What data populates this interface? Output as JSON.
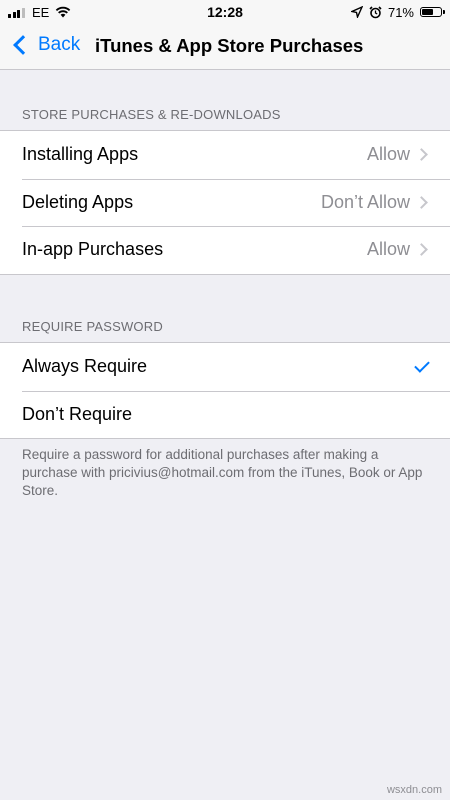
{
  "status_bar": {
    "carrier": "EE",
    "time": "12:28",
    "battery_percent": "71%",
    "battery_level": 0.71,
    "icons": [
      "signal-icon",
      "wifi-icon",
      "location-icon",
      "alarm-icon",
      "battery-icon"
    ]
  },
  "nav": {
    "back_label": "Back",
    "title": "iTunes & App Store Purchases"
  },
  "store_section": {
    "header": "STORE PURCHASES & RE-DOWNLOADS",
    "rows": [
      {
        "label": "Installing Apps",
        "value": "Allow"
      },
      {
        "label": "Deleting Apps",
        "value": "Don’t Allow"
      },
      {
        "label": "In-app Purchases",
        "value": "Allow"
      }
    ]
  },
  "password_section": {
    "header": "REQUIRE PASSWORD",
    "rows": [
      {
        "label": "Always Require",
        "selected": true
      },
      {
        "label": "Don’t Require",
        "selected": false
      }
    ],
    "footer": "Require a password for additional purchases after making a purchase with pricivius@hotmail.com from the iTunes, Book or App Store."
  },
  "watermark": "wsxdn.com",
  "colors": {
    "accent": "#007aff",
    "background": "#efeff4",
    "secondary_text": "#8e8e93"
  }
}
